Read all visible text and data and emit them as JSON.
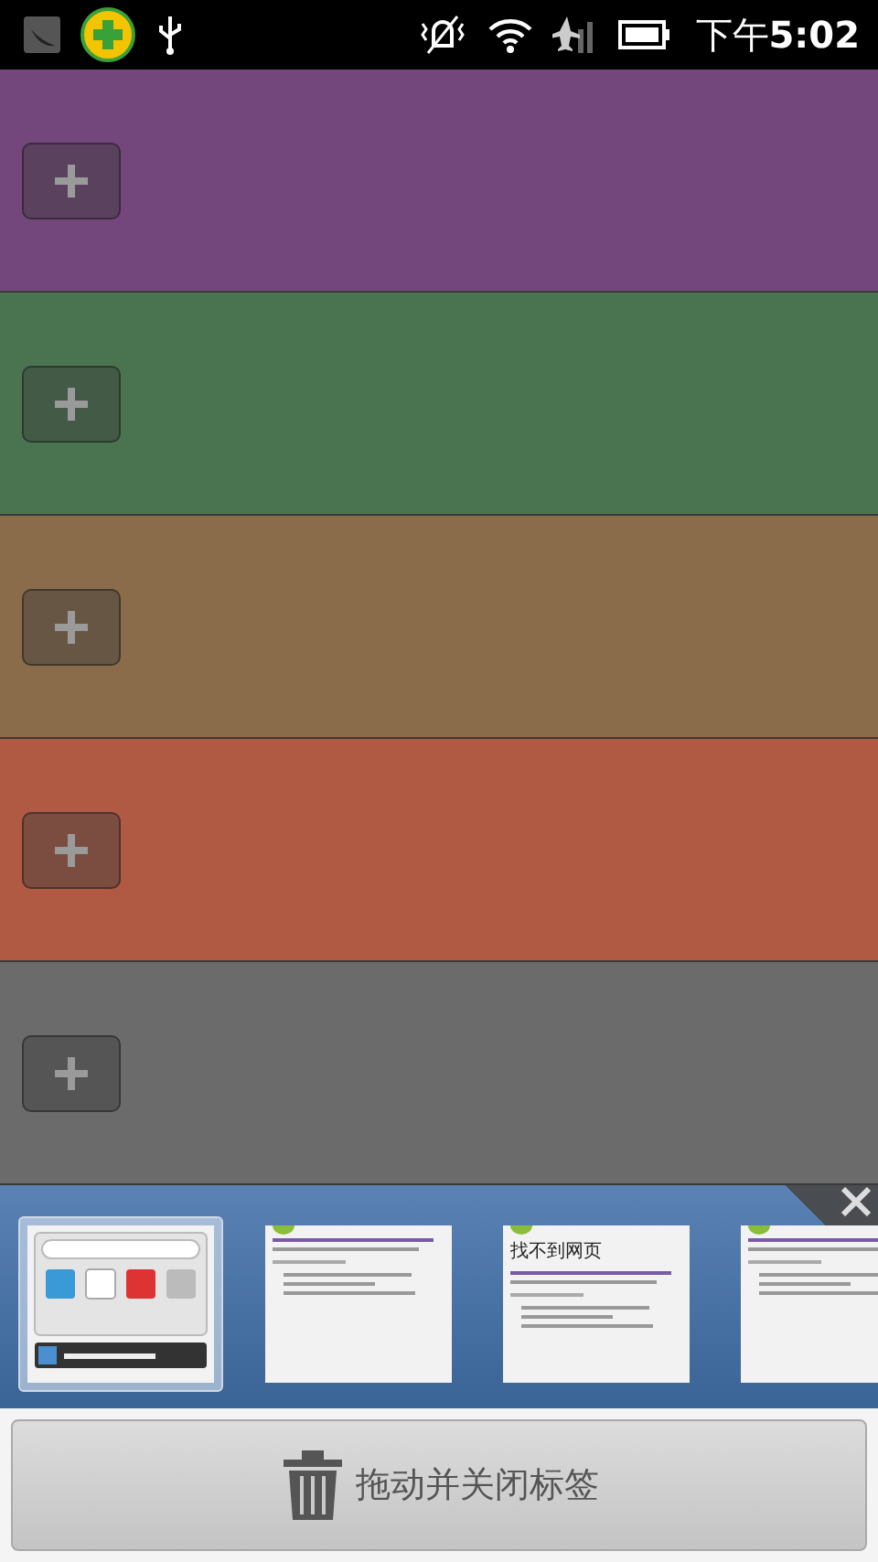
{
  "status_bar": {
    "time": "下午**5:02**"
  },
  "slots": [
    {
      "color": "#74477c"
    },
    {
      "color": "#4a7350"
    },
    {
      "color": "#8a6c4a"
    },
    {
      "color": "#b05a44"
    },
    {
      "color": "#6b6b6b"
    }
  ],
  "tabs": [
    {
      "kind": "start",
      "selected": true
    },
    {
      "kind": "page",
      "selected": false
    },
    {
      "kind": "page",
      "selected": false,
      "title": "找不到网页"
    },
    {
      "kind": "page",
      "selected": false
    }
  ],
  "close_button": {
    "label": "拖动并关闭标签"
  }
}
